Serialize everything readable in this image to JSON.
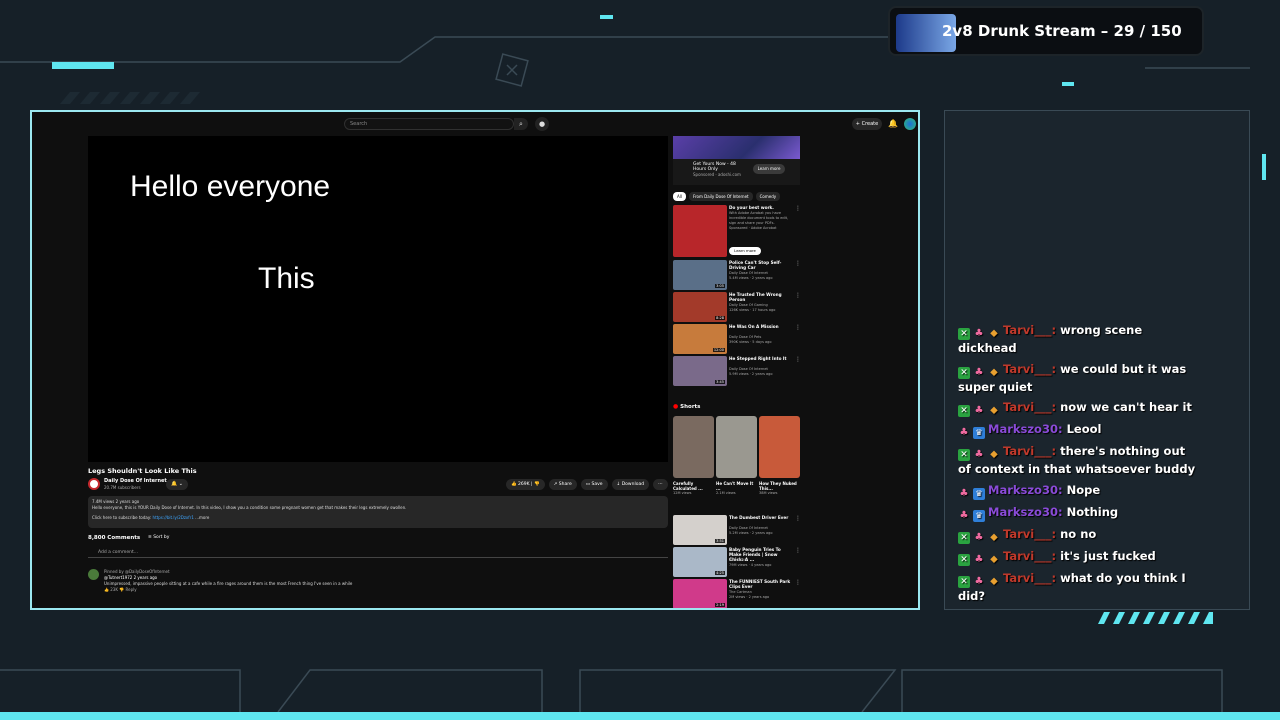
{
  "stream": {
    "title": "2v8 Drunk Stream – 29 / 150"
  },
  "colors": {
    "accent_cyan": "#5fe6f0",
    "frame_border": "#9ce8f0",
    "background": "#162028",
    "tarvi_color": "#c0392b",
    "markszo_color": "#8a4bd8"
  },
  "youtube": {
    "search_placeholder": "Search",
    "create_label": "+ Create",
    "video_text_line1": "Hello everyone",
    "video_text_line2": "This",
    "video_title": "Legs Shouldn't Look Like This",
    "channel_name": "Daily Dose Of Internet",
    "channel_subs": "20.7M subscribers",
    "like_count": "269K",
    "share_label": "Share",
    "save_label": "Save",
    "download_label": "Download",
    "description_meta": "7.4M views  2 years ago",
    "description_text": "Hello everyone, this is YOUR Daily Dose of Internet. In this video, I show you a condition some pregnant women get that makes their legs extremely swollen.",
    "description_sub": "Click here to subscribe today: ",
    "description_link": "https://bit.ly/2Dzxfr1",
    "description_more": "...more",
    "comments_count": "8,800 Comments",
    "sort_by": "Sort by",
    "add_comment": "Add a comment...",
    "comment_pinned": "Pinned by @DailyDoseOfInternet",
    "comment_user": "@Tutnert1972  2 years ago",
    "comment_text": "Unimpressed, impassive people sitting at a cafe while a fire rages around them is the most French thing I've seen in a while",
    "comment_likes": "23K",
    "comment_reply": "Reply"
  },
  "sidebar": {
    "ad_title": "Get Yours Now - 48 Hours Only",
    "ad_sponsored": "Sponsored · adoshi.com",
    "ad_learn": "Learn more",
    "chips": [
      "All",
      "From Daily Dose Of Internet",
      "Comedy"
    ],
    "recs": [
      {
        "title": "Do your best work.",
        "meta": "With Adobe Acrobat you have incredible document tools to edit, sign and share your PDFs.",
        "sub": "Sponsored · Adobe Acrobat",
        "duration": "",
        "thumb": "#b8262a"
      },
      {
        "title": "Police Can't Stop Self-Driving Car",
        "meta": "Daily Dose Of Internet",
        "sub": "5.4M views · 2 years ago",
        "duration": "3:05",
        "thumb": "#5a6f88"
      },
      {
        "title": "He Trusted The Wrong Person",
        "meta": "Daily Dose Of Gaming",
        "sub": "126K views · 17 hours ago",
        "duration": "8:28",
        "thumb": "#a33a2a"
      },
      {
        "title": "He Was On A Mission",
        "meta": "Daily Dose Of Pets",
        "sub": "390K views · 5 days ago",
        "duration": "12:00",
        "thumb": "#c77b3c"
      },
      {
        "title": "He Stepped Right Into It",
        "meta": "Daily Dose Of Internet",
        "sub": "5.9M views · 2 years ago",
        "duration": "3:45",
        "thumb": "#7a6a8a"
      },
      {
        "title": "The Dumbest Driver Ever",
        "meta": "Daily Dose Of Internet",
        "sub": "5.2M views · 2 years ago",
        "duration": "3:51",
        "thumb": "#d4d0cc"
      },
      {
        "title": "Baby Penguin Tries To Make Friends | Snow Chick: A ...",
        "meta": "BBC Earth",
        "sub": "79M views · 4 years ago",
        "duration": "4:25",
        "thumb": "#aab8c8"
      },
      {
        "title": "The FUNNIEST South Park Clips Ever",
        "meta": "The Cartman",
        "sub": "2M views · 2 years ago",
        "duration": "2:19",
        "thumb": "#d03a8a"
      }
    ],
    "ad_learn_small": "Learn more",
    "shorts_label": "Shorts",
    "shorts": [
      {
        "title": "Carefully Calculated ...",
        "views": "12M views",
        "color": "#7a6a60"
      },
      {
        "title": "He Can't Move It ...",
        "views": "2.1M views",
        "color": "#9a9890"
      },
      {
        "title": "How They Nuked This...",
        "views": "38M views",
        "color": "#c85a3a"
      }
    ]
  },
  "chat": {
    "messages": [
      {
        "user": "Tarvi___",
        "color": "#c0392b",
        "badges": [
          "green",
          "pink",
          "gold"
        ],
        "text": "wrong scene dickhead"
      },
      {
        "user": "Tarvi___",
        "color": "#c0392b",
        "badges": [
          "green",
          "pink",
          "gold"
        ],
        "text": "we could but it was super quiet"
      },
      {
        "user": "Tarvi___",
        "color": "#c0392b",
        "badges": [
          "green",
          "pink",
          "gold"
        ],
        "text": "now we can't hear it"
      },
      {
        "user": "Markszo30",
        "color": "#8a4bd8",
        "badges": [
          "pink",
          "blue"
        ],
        "text": "Leool"
      },
      {
        "user": "Tarvi___",
        "color": "#c0392b",
        "badges": [
          "green",
          "pink",
          "gold"
        ],
        "text": "there's nothing out of context in that whatsoever buddy"
      },
      {
        "user": "Markszo30",
        "color": "#8a4bd8",
        "badges": [
          "pink",
          "blue"
        ],
        "text": "Nope"
      },
      {
        "user": "Markszo30",
        "color": "#8a4bd8",
        "badges": [
          "pink",
          "blue"
        ],
        "text": "Nothing"
      },
      {
        "user": "Tarvi___",
        "color": "#c0392b",
        "badges": [
          "green",
          "pink",
          "gold"
        ],
        "text": "no no"
      },
      {
        "user": "Tarvi___",
        "color": "#c0392b",
        "badges": [
          "green",
          "pink",
          "gold"
        ],
        "text": "it's just fucked"
      },
      {
        "user": "Tarvi___",
        "color": "#c0392b",
        "badges": [
          "green",
          "pink",
          "gold"
        ],
        "text": "what do you think I did?"
      }
    ]
  }
}
